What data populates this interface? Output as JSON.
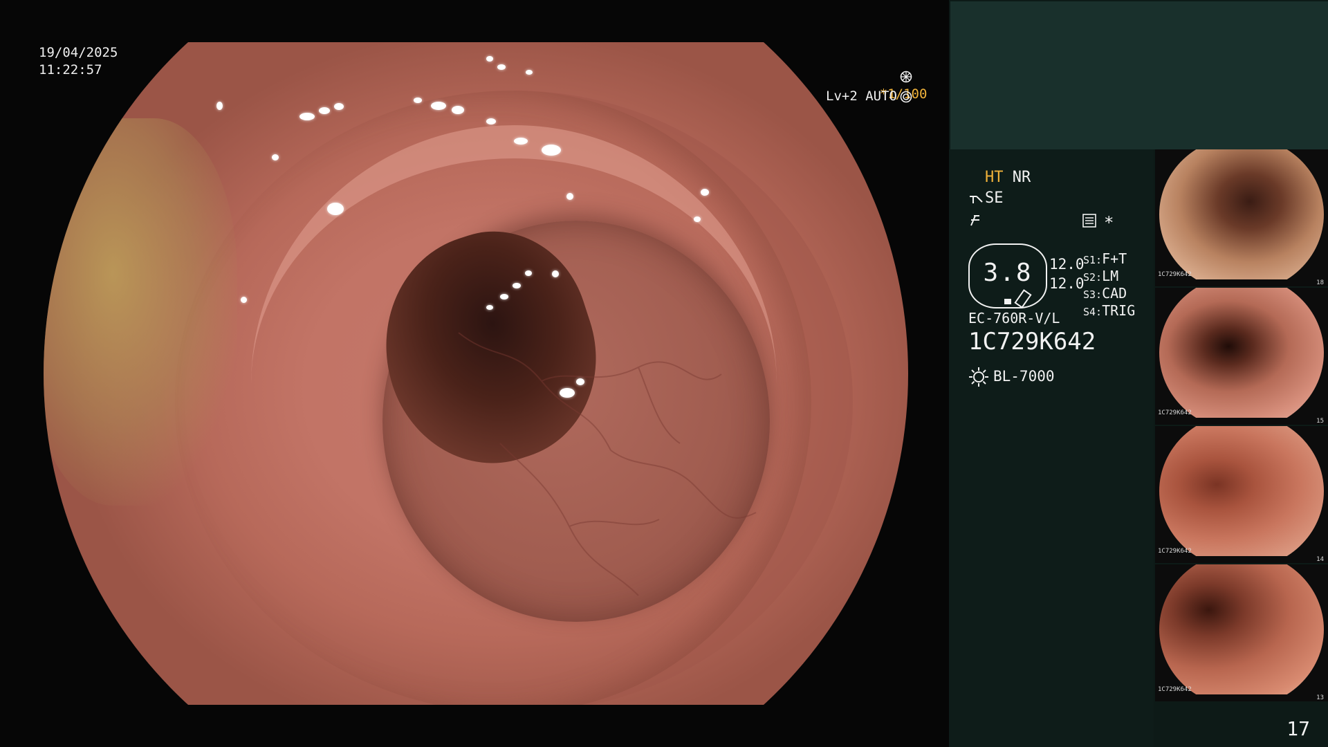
{
  "overlay": {
    "date": "19/04/2025",
    "time": "11:22:57",
    "shutter": "*1/100",
    "level": "Lv+2 AUTO"
  },
  "panel": {
    "ht": "HT",
    "nr": "NR",
    "se": "SE",
    "zoom": "3.8",
    "value_1": "12.0",
    "value_2": "12.0",
    "switches": [
      {
        "key": "S1:",
        "value": "F+T"
      },
      {
        "key": "S2:",
        "value": "LM"
      },
      {
        "key": "S3:",
        "value": "CAD"
      },
      {
        "key": "S4:",
        "value": "TRIG"
      }
    ],
    "scope_model": "EC-760R-V/L",
    "scope_serial": "1C729K642",
    "light_source": "BL-7000",
    "page_number": "17"
  },
  "thumbnails": [
    {
      "serial": "1C729K642",
      "index": "18"
    },
    {
      "serial": "1C729K642",
      "index": "15"
    },
    {
      "serial": "1C729K642",
      "index": "14"
    },
    {
      "serial": "1C729K642",
      "index": "13"
    }
  ],
  "icons": [
    "shutter-wheel-icon",
    "auto-iris-icon",
    "scope-mode-icon",
    "freeze-icon",
    "menu-list-icon",
    "asterisk-icon",
    "light-source-icon"
  ],
  "colors": {
    "accent": "#f0b23a",
    "panel_bg": "#0e1c19",
    "panel_header": "#19302c"
  }
}
